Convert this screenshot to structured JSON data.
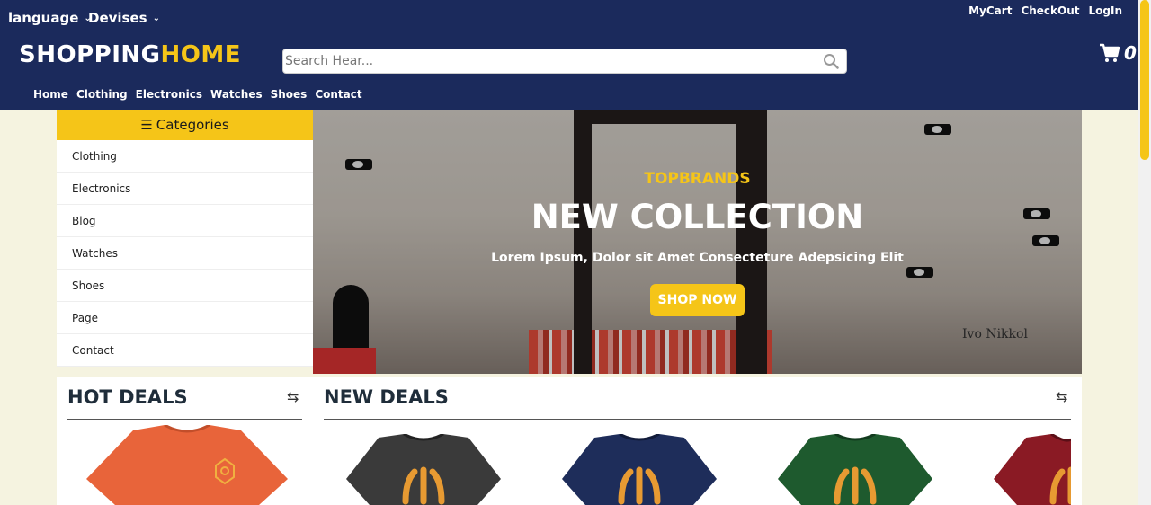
{
  "header": {
    "language_label": "language",
    "devises_label": "Devises",
    "top_links": [
      "MyCart",
      "CheckOut",
      "LogIn"
    ],
    "logo_part1": "SHOPPING",
    "logo_part2": "HOME",
    "search_placeholder": "Search Hear...",
    "cart_count": "0",
    "nav": [
      "Home",
      "Clothing",
      "Electronics",
      "Watches",
      "Shoes",
      "Contact"
    ]
  },
  "categories": {
    "title": "Categories",
    "items": [
      "Clothing",
      "Electronics",
      "Blog",
      "Watches",
      "Shoes",
      "Page",
      "Contact"
    ]
  },
  "hero": {
    "kicker": "TOPBRANDS",
    "title": "NEW COLLECTION",
    "subtitle": "Lorem Ipsum, Dolor sit Amet Consecteture Adepsicing Elit",
    "button": "SHOP NOW",
    "store_sign": "Ivo Nikkol"
  },
  "hot_deals": {
    "title": "HOT DEALS",
    "products": [
      {
        "color": "#e8643a",
        "icon": "orange-tshirt-icon"
      }
    ]
  },
  "new_deals": {
    "title": "NEW DEALS",
    "products": [
      {
        "color": "#3a3a3a",
        "icon": "black-tshirt-icon"
      },
      {
        "color": "#1e2d5a",
        "icon": "navy-tshirt-icon"
      },
      {
        "color": "#1e5a2e",
        "icon": "green-tshirt-icon"
      },
      {
        "color": "#8a1a24",
        "icon": "maroon-tshirt-icon"
      }
    ]
  },
  "colors": {
    "header_bg": "#1b2a5c",
    "accent": "#f5c518",
    "page_bg": "#f5f3e0"
  }
}
